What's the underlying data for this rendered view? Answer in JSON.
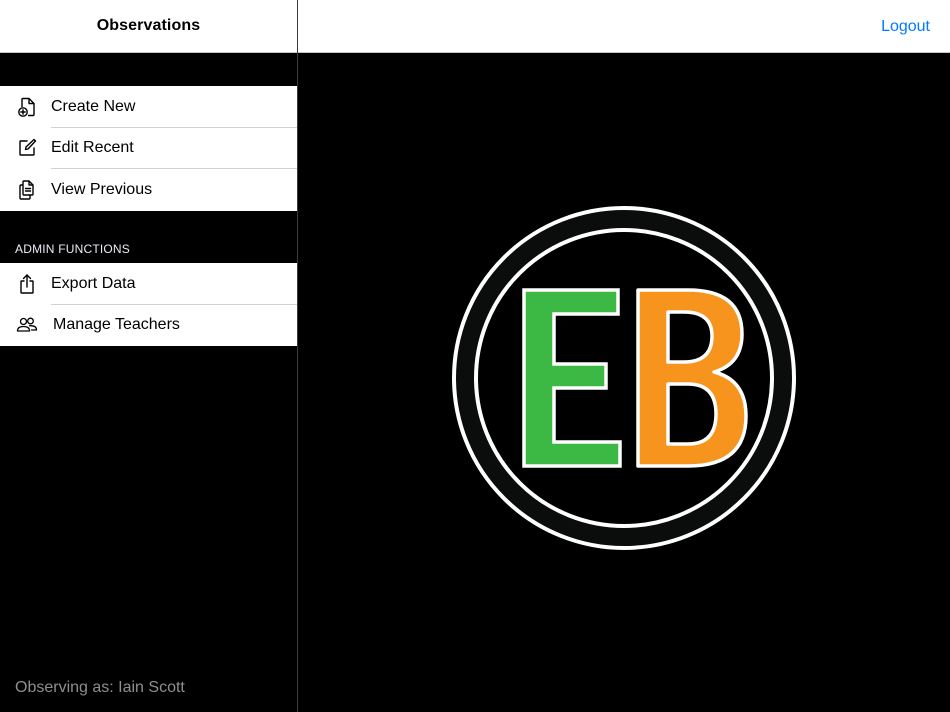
{
  "sidebar": {
    "title": "Observations",
    "main_items": [
      {
        "label": "Create New",
        "icon": "document-plus-icon"
      },
      {
        "label": "Edit Recent",
        "icon": "edit-square-icon"
      },
      {
        "label": "View Previous",
        "icon": "documents-icon"
      }
    ],
    "admin_section_title": "ADMIN FUNCTIONS",
    "admin_items": [
      {
        "label": "Export Data",
        "icon": "share-export-icon"
      },
      {
        "label": "Manage Teachers",
        "icon": "people-icon"
      }
    ],
    "footer_text": "Observing as: Iain Scott"
  },
  "header": {
    "logout_label": "Logout"
  },
  "logo": {
    "text_left": "E",
    "text_right": "B",
    "colors": {
      "left_letter": "#3cb944",
      "right_letter": "#f7941d",
      "ring": "#ffffff",
      "background": "#000000"
    }
  },
  "colors": {
    "accent": "#007aff",
    "sidebar_bg": "#000000",
    "row_bg": "#ffffff"
  }
}
